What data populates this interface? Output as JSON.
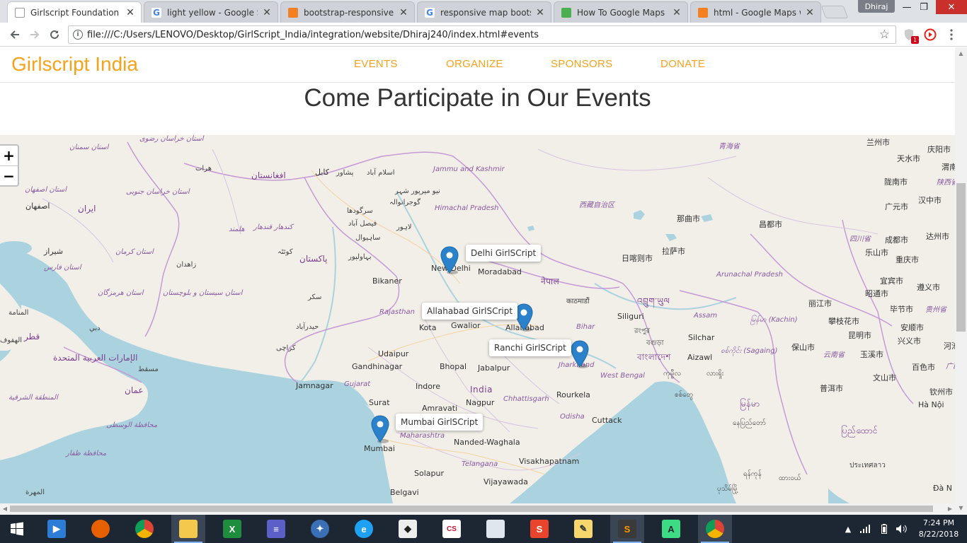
{
  "browser": {
    "tabs": [
      {
        "title": "Girlscript Foundation",
        "icon": "page-icon",
        "active": true
      },
      {
        "title": "light yellow - Google Sea",
        "icon": "google-icon"
      },
      {
        "title": "bootstrap-responsive col",
        "icon": "stackoverflow-icon"
      },
      {
        "title": "responsive map bootstra",
        "icon": "google-icon"
      },
      {
        "title": "How To Google Maps",
        "icon": "w3schools-icon"
      },
      {
        "title": "html - Google Maps with",
        "icon": "stackoverflow-icon"
      }
    ],
    "close_glyph": "✕",
    "user_name": "Dhiraj",
    "window_controls": {
      "minimize": "—",
      "maximize": "❐",
      "close": "✕"
    },
    "url": "file:///C:/Users/LENOVO/Desktop/GirlScript_India/integration/website/Dhiraj240/index.html#events",
    "extension_badge": "1"
  },
  "site": {
    "brand": "Girlscript India",
    "nav": [
      "EVENTS",
      "ORGANIZE",
      "SPONSORS",
      "DONATE"
    ],
    "section_title": "Come Participate in Our Events",
    "colors": {
      "accent": "#f7a21b",
      "marker": "#2b82cb",
      "water": "#aad3df",
      "land": "#f2efe9"
    }
  },
  "map": {
    "zoom_in": "+",
    "zoom_out": "−",
    "popups": [
      "Delhi GirlSCript",
      "Allahabad GirlSCript",
      "Ranchi GirlSCript",
      "Mumbai GirlSCript"
    ],
    "labels": {
      "c1": "استان خراسان رضوی",
      "c2": "استان سمنان",
      "c3": "هرات",
      "c4": "افغانستان",
      "c5": "کابل",
      "c6": "پشاور",
      "c7": "اسلام آباد",
      "c8": "Jammu and Kashmir",
      "c9": "استان اصفهان",
      "c10": "اصفهان",
      "c11": "ایران",
      "c12": "استان خراسان جنوبی",
      "c13": "هلمند",
      "c14": "کندهار قندهار",
      "c15": "نیو میرپور شہر",
      "c16": "گوجرانوالہ",
      "c17": "سرگودھا",
      "c18": "فیصل آباد",
      "c19": "لاہور",
      "c20": "ساہیوال",
      "c21": "Himachal Pradesh",
      "c22": "西藏自治区",
      "c23": "青海省",
      "c24": "兰州市",
      "c25": "天水市",
      "c26": "庆阳市",
      "c27": "渭南",
      "c28": "陇南市",
      "c29": "广元市",
      "c30": "汉中市",
      "c31": "陕西省",
      "c32": "那曲市",
      "c33": "昌都市",
      "c34": "四川省",
      "c35": "成都市",
      "c36": "达州市",
      "c37": "شیراز",
      "c38": "استان کرمان",
      "c39": "کوئٹہ",
      "c40": "پاکستان",
      "c41": "بہاولپور",
      "c42": "New Delhi",
      "c43": "Moradabad",
      "c44": "日喀则市",
      "c45": "拉萨市",
      "c46": "乐山市",
      "c47": "重庆市",
      "c48": "استان فارس",
      "c49": "زاهدان",
      "c50": "Bikaner",
      "c51": "नेपाल",
      "c52": "काठमाडौं",
      "c53": "Arunachal Pradesh",
      "c54": "宜宾市",
      "c55": "遵义市",
      "c56": "昭通市",
      "c57": "استان هرمزگان",
      "c58": "استان سیستان و بلوچستان",
      "c59": "سکر",
      "c60": "Rajasthan",
      "c61": "Gwalior",
      "c62": "Allahabad",
      "c63": "Siliguri",
      "c64": "འབྲུག་ཡུལ",
      "c65": "丽江市",
      "c66": "毕节市",
      "c67": "贵州省",
      "c68": "المنامة",
      "c69": "دبي",
      "c70": "قطر",
      "c71": "الهفوف",
      "c72": "حیدرآباد",
      "c73": "Kota",
      "c74": "Bihar",
      "c75": "Assam",
      "c76": "မြန်မာ (Kachin)",
      "c77": "攀枝花市",
      "c78": "安顺市",
      "c79": "كراچی",
      "c80": "Udaipur",
      "c81": "রংপুর",
      "c82": "বগুড়া",
      "c83": "Silchar",
      "c84": "保山市",
      "c85": "昆明市",
      "c86": "兴义市",
      "c87": "الإمارات العربية المتحدة",
      "c88": "مسقط",
      "c89": "Gandhinagar",
      "c90": "Bhopal",
      "c91": "Jabalpur",
      "c92": "Jharkhand",
      "c93": "West Bengal",
      "c94": "বাংলাদেশ",
      "c95": "Aizawl",
      "c96": "စစ်ကိုင်း (Sagaing)",
      "c97": "云南省",
      "c98": "玉溪市",
      "c99": "河池",
      "c100": "عمان",
      "c101": "Jamnagar",
      "c102": "Gujarat",
      "c103": "Indore",
      "c104": "India",
      "c105": "Chhattisgarh",
      "c106": "Rourkela",
      "c107": "ကုမ္ဗီလ",
      "c108": "လားရှိုး",
      "c109": "文山市",
      "c110": "百色市",
      "c111": "广西",
      "c112": "المنطقة الشرقية",
      "c113": "Surat",
      "c114": "Nagpur",
      "c115": "Cuttack",
      "c116": "Odisha",
      "c117": "စစ်တွေ",
      "c118": "普洱市",
      "c119": "钦州市",
      "c120": "Amravati",
      "c121": "محافظة الوسطى",
      "c122": "Mumbai",
      "c123": "Maharashtra",
      "c124": "Nanded-Waghala",
      "c125": "Visakhapatnam",
      "c126": "မြန်မာ",
      "c127": "နေပြည်တော်",
      "c128": "ပြည်ထောင်",
      "c129": "Hà Nội",
      "c130": "محافظة ظفار",
      "c131": "Solapur",
      "c132": "Telangana",
      "c133": "Vijayawada",
      "c134": "ประเทศลาว",
      "c135": "Belgavi",
      "c136": "المهرة",
      "c137": "ရန်ကုန်",
      "c138": "ထားဝယ်",
      "c139": "ပုသိမ်မြို့",
      "c140": "Đà N"
    }
  },
  "taskbar": {
    "apps": [
      "start-icon",
      "video-app-icon",
      "firefox-icon",
      "chrome-icon",
      "file-explorer-icon",
      "excel-icon",
      "app-icon",
      "compass-app-icon",
      "ie-icon",
      "cap-app-icon",
      "cs-eagle-icon",
      "doc-app-icon",
      "s-app-icon",
      "image-app-icon",
      "sublime-icon",
      "android-studio-icon",
      "chrome-icon"
    ],
    "tray_expand": "▲",
    "time": "7:24 PM",
    "date": "8/22/2018"
  }
}
